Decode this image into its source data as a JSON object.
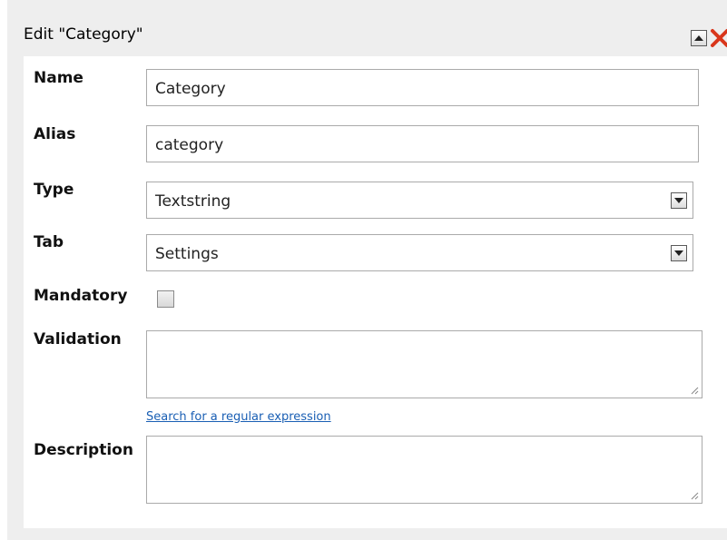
{
  "dialog": {
    "title": "Edit \"Category\"",
    "icons": {
      "collapse": "caret-up-icon",
      "close": "close-x-icon"
    }
  },
  "fields": {
    "name": {
      "label": "Name",
      "value": "Category"
    },
    "alias": {
      "label": "Alias",
      "value": "category"
    },
    "type": {
      "label": "Type",
      "value": "Textstring"
    },
    "tab": {
      "label": "Tab",
      "value": "Settings"
    },
    "mandatory": {
      "label": "Mandatory",
      "checked": false
    },
    "validation": {
      "label": "Validation",
      "value": "",
      "link": "Search for a regular expression"
    },
    "description": {
      "label": "Description",
      "value": ""
    }
  },
  "colors": {
    "close_icon": "#d9361b",
    "link": "#1a5fb4",
    "panel_bg": "#eeeeee"
  }
}
